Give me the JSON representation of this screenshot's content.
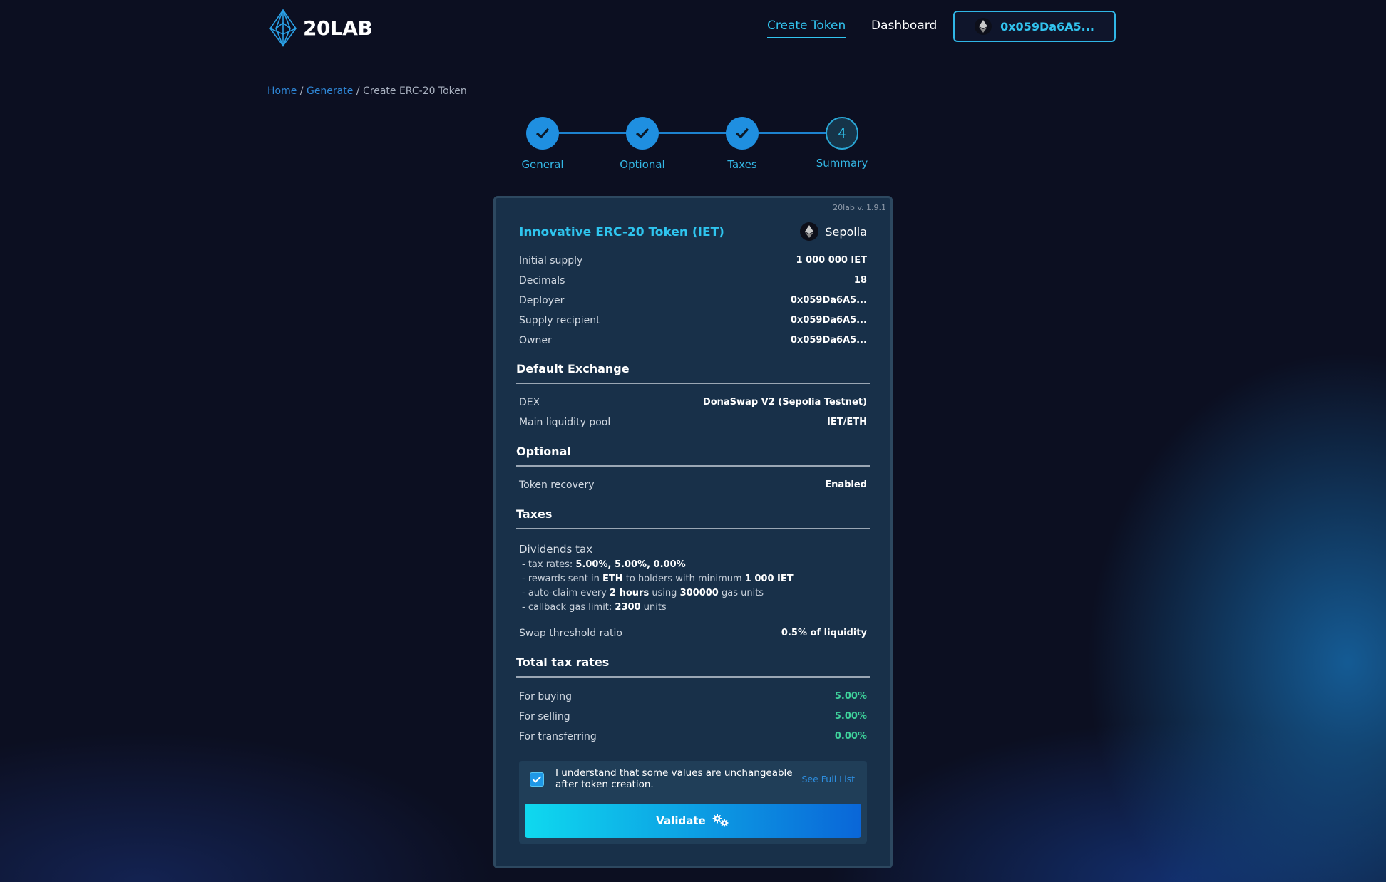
{
  "header": {
    "logo_text": "20LAB",
    "nav": {
      "create": "Create Token",
      "dashboard": "Dashboard"
    },
    "wallet_address": "0x059Da6A5..."
  },
  "breadcrumb": {
    "home": "Home",
    "sep1": " / ",
    "generate": "Generate",
    "sep2": " / ",
    "current": "Create ERC-20 Token"
  },
  "stepper": {
    "steps": [
      {
        "label": "General",
        "state": "done"
      },
      {
        "label": "Optional",
        "state": "done"
      },
      {
        "label": "Taxes",
        "state": "done"
      },
      {
        "label": "Summary",
        "state": "current",
        "number": "4"
      }
    ]
  },
  "summary": {
    "version": "20lab v. 1.9.1",
    "token_title": "Innovative ERC-20 Token (IET)",
    "network": "Sepolia",
    "general": [
      {
        "label": "Initial supply",
        "value": "1 000 000 IET"
      },
      {
        "label": "Decimals",
        "value": "18"
      },
      {
        "label": "Deployer",
        "value": "0x059Da6A5..."
      },
      {
        "label": "Supply recipient",
        "value": "0x059Da6A5..."
      },
      {
        "label": "Owner",
        "value": "0x059Da6A5..."
      }
    ],
    "exchange": {
      "heading": "Default Exchange",
      "rows": [
        {
          "label": "DEX",
          "value": "DonaSwap V2 (Sepolia Testnet)"
        },
        {
          "label": "Main liquidity pool",
          "value": "IET/ETH"
        }
      ]
    },
    "optional": {
      "heading": "Optional",
      "rows": [
        {
          "label": "Token recovery",
          "value": "Enabled"
        }
      ]
    },
    "taxes": {
      "heading": "Taxes",
      "dividends_title": "Dividends tax",
      "rates_prefix": "- tax rates: ",
      "rates_value": "5.00%, 5.00%, 0.00%",
      "rewards_prefix": "- rewards sent in ",
      "rewards_token": "ETH",
      "rewards_mid": " to holders with minimum ",
      "rewards_min": "1 000 IET",
      "autoclaim_prefix": "- auto-claim every ",
      "autoclaim_interval": "2 hours",
      "autoclaim_mid": " using ",
      "autoclaim_gas": "300000",
      "autoclaim_suffix": " gas units",
      "callback_prefix": "- callback gas limit: ",
      "callback_value": "2300",
      "callback_suffix": " units",
      "swap_label": "Swap threshold ratio",
      "swap_value": "0.5% of liquidity"
    },
    "total": {
      "heading": "Total tax rates",
      "rows": [
        {
          "label": "For buying",
          "value": "5.00%"
        },
        {
          "label": "For selling",
          "value": "5.00%"
        },
        {
          "label": "For transferring",
          "value": "0.00%"
        }
      ]
    },
    "confirm": {
      "text": "I understand that some values are unchangeable after token creation.",
      "see_full_list": "See Full List",
      "checked": true
    },
    "validate_label": "Validate"
  },
  "colors": {
    "accent": "#32c4ef",
    "green": "#3ed19b",
    "card_bg": "#183049",
    "page_bg": "#0c0f21"
  },
  "icons": [
    "eth-diamond-icon",
    "check-icon",
    "gears-icon",
    "checkbox-check-icon"
  ]
}
